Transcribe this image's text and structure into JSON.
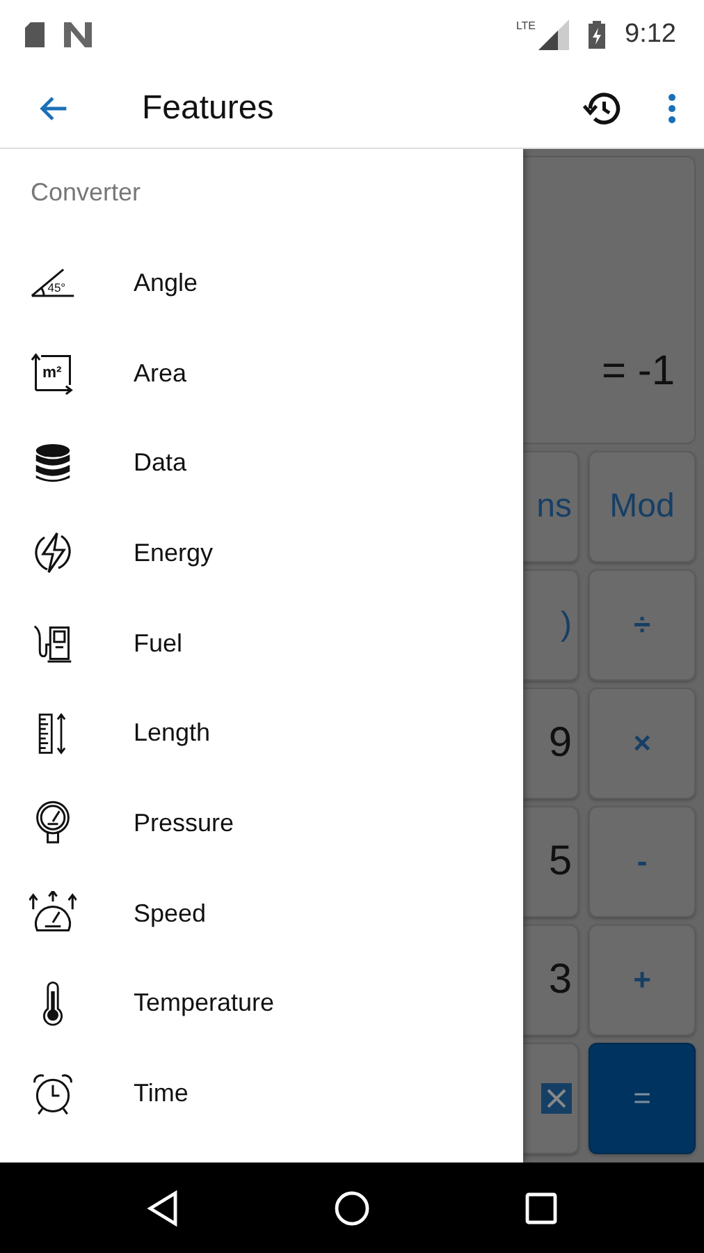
{
  "status_bar": {
    "network": "LTE",
    "time": "9:12"
  },
  "app_bar": {
    "title": "Features"
  },
  "drawer": {
    "section": "Converter",
    "items": [
      {
        "label": "Angle",
        "kind": "angle",
        "icon_text": "45°"
      },
      {
        "label": "Area",
        "kind": "area",
        "icon_text": "m²"
      },
      {
        "label": "Data",
        "kind": "data"
      },
      {
        "label": "Energy",
        "kind": "energy"
      },
      {
        "label": "Fuel",
        "kind": "fuel"
      },
      {
        "label": "Length",
        "kind": "length"
      },
      {
        "label": "Pressure",
        "kind": "pressure"
      },
      {
        "label": "Speed",
        "kind": "speed"
      },
      {
        "label": "Temperature",
        "kind": "temperature"
      },
      {
        "label": "Time",
        "kind": "time"
      }
    ]
  },
  "calculator": {
    "result": "= -1",
    "keys": [
      {
        "label": "ns",
        "kind": "func"
      },
      {
        "label": "Mod",
        "kind": "func"
      },
      {
        "label": ")",
        "kind": "func"
      },
      {
        "label": "÷",
        "kind": "op"
      },
      {
        "label": "9",
        "kind": "digit"
      },
      {
        "label": "×",
        "kind": "op"
      },
      {
        "label": "5",
        "kind": "digit"
      },
      {
        "label": "-",
        "kind": "op"
      },
      {
        "label": "3",
        "kind": "digit"
      },
      {
        "label": "+",
        "kind": "op"
      },
      {
        "kind": "delete"
      },
      {
        "label": "=",
        "kind": "equals"
      }
    ]
  }
}
